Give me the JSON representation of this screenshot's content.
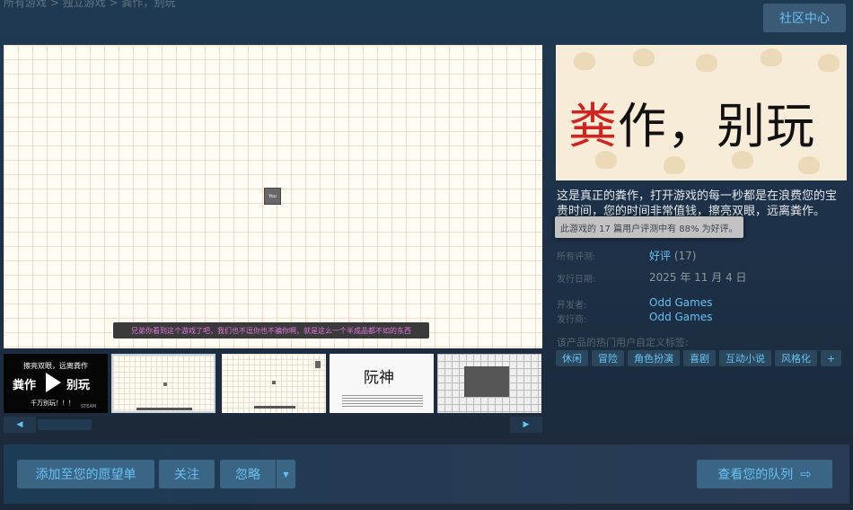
{
  "header": {
    "top_text": "所有游戏 > 独立游戏 > 粪作，别玩",
    "community_button": "社区中心"
  },
  "media": {
    "player_label": "You",
    "subtitle": "兄弟你看到这个游戏了吧，我们也不逗你也不骗你啊，就是这么一个半成品都不如的东西"
  },
  "thumbnails": {
    "t0_line1": "擦亮双眼，远离粪作",
    "t0_big_left": "粪作",
    "t0_big_right": "别玩",
    "t0_line2": "千万别玩！！！",
    "t0_steam": "STEAM",
    "t3_title": "阮神"
  },
  "scroll": {
    "left_arrow": "◀",
    "right_arrow": "▶"
  },
  "capsule": {
    "title_red": "粪",
    "title_rest": "作，别玩"
  },
  "description": "这是真正的粪作，打开游戏的每一秒都是在浪费您的宝贵时间，您的时间非常值钱，擦亮双眼，远离粪作。",
  "tooltip": "此游戏的 17 篇用户评测中有 88% 为好评。",
  "meta": {
    "reviews_label": "所有评测:",
    "reviews_value": "好评",
    "reviews_count": "(17)",
    "release_label": "发行日期:",
    "release_value": "2025 年 11 月 4 日",
    "developer_label": "开发者:",
    "developer_value": "Odd Games",
    "publisher_label": "发行商:",
    "publisher_value": "Odd Games"
  },
  "tags": {
    "label": "该产品的热门用户自定义标签:",
    "items": [
      "休闲",
      "冒险",
      "角色扮演",
      "喜剧",
      "互动小说",
      "风格化",
      "+"
    ]
  },
  "actions": {
    "wishlist": "添加至您的愿望单",
    "follow": "关注",
    "ignore": "忽略",
    "ignore_dropdown": "▼",
    "queue": "查看您的队列",
    "queue_arrow": "⇨"
  }
}
